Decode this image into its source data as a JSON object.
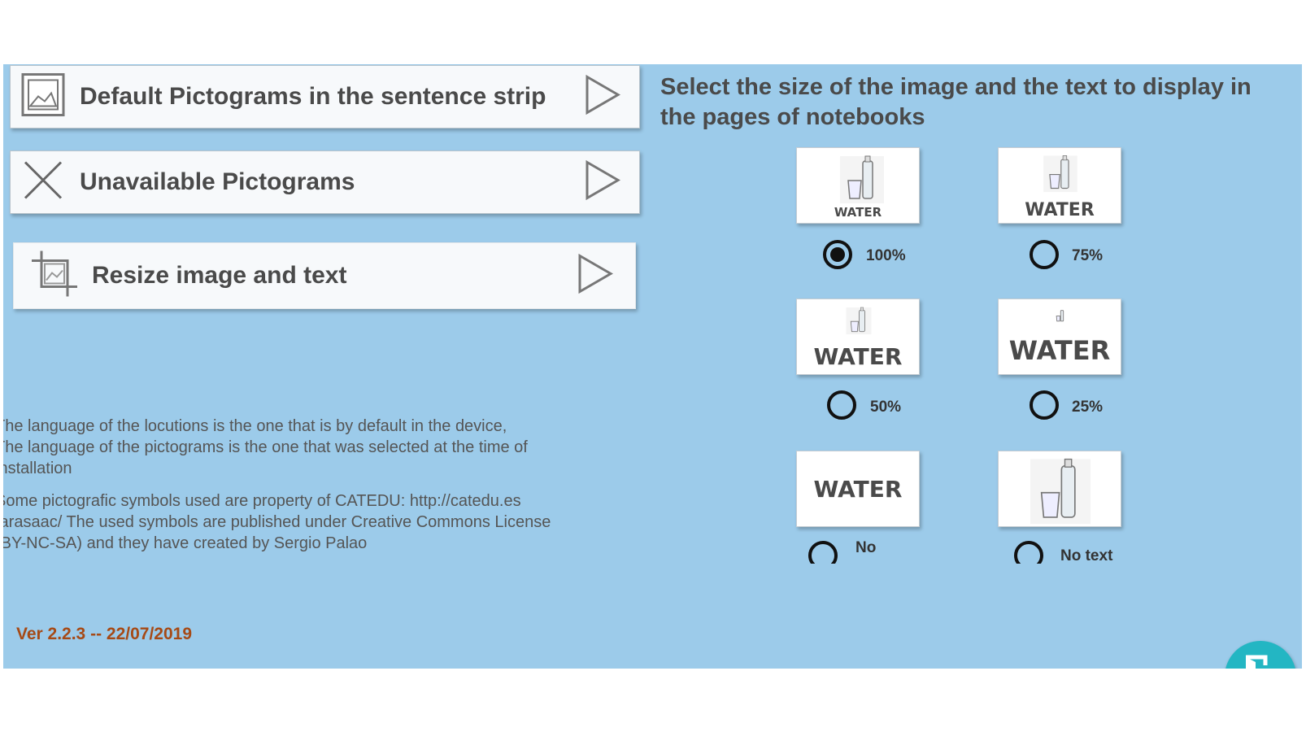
{
  "menu": {
    "items": [
      {
        "label": "Default Pictograms in the sentence strip",
        "icon": "image-icon"
      },
      {
        "label": "Unavailable Pictograms",
        "icon": "close-icon"
      },
      {
        "label": "Resize image and text",
        "icon": "crop-icon"
      }
    ]
  },
  "info": {
    "language_note": "The language of the locutions is the one that is by default in the device,\nThe language of the pictograms is the one that was selected at the time of\ninstallation",
    "license_note": "Some pictografic symbols used are property of CATEDU: http://catedu.es\n/arasaac/ The used symbols are published under Creative Commons License\n(BY-NC-SA) and they have created by Sergio Palao"
  },
  "version": "Ver 2.2.3 -- 22/07/2019",
  "size_selector": {
    "heading": "Select the size of the image and the text to display in the pages of notebooks",
    "card_word": "WATER",
    "selected": "100%",
    "options": [
      {
        "label": "100%"
      },
      {
        "label": "75%"
      },
      {
        "label": "50%"
      },
      {
        "label": "25%"
      },
      {
        "label": "No"
      },
      {
        "label": "No text"
      }
    ]
  },
  "colors": {
    "panel_bg": "#9ccbea",
    "version_text": "#a64a16",
    "exit_button": "#23b6c3"
  },
  "exit_button": {
    "icon": "exit-door-icon"
  }
}
